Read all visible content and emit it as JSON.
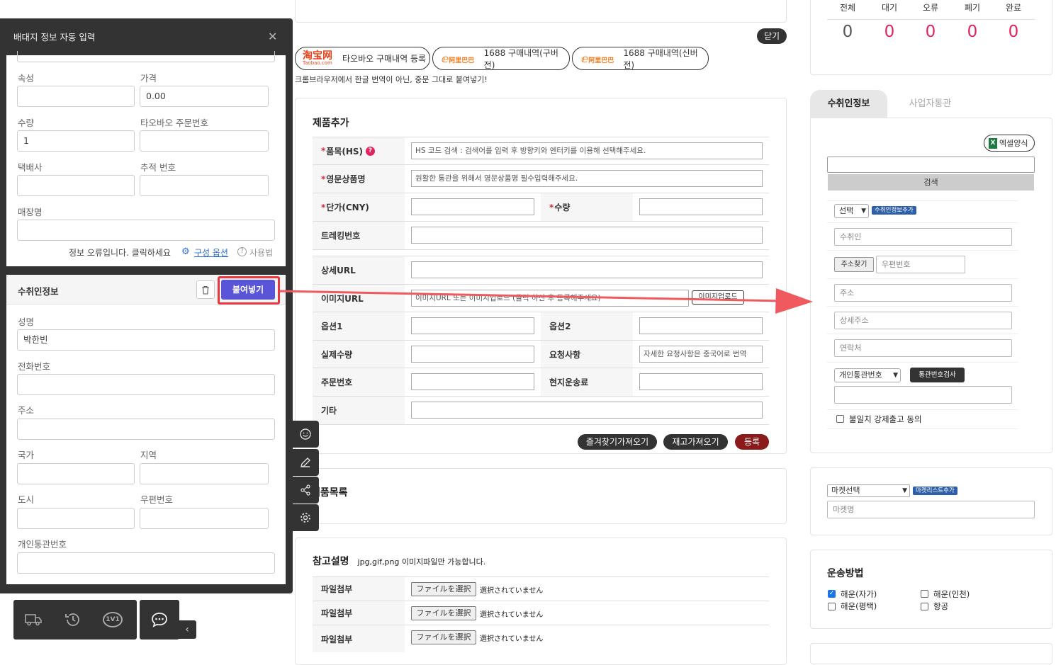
{
  "topcard": {
    "close_label": "닫기"
  },
  "purchase_buttons": [
    {
      "logo_main": "淘宝网",
      "logo_sub": "Taobao.com",
      "label": "타오바오 구매내역 등록"
    },
    {
      "logo_main": "阿里巴巴",
      "label": "1688 구매내역(구버전)"
    },
    {
      "logo_main": "阿里巴巴",
      "label": "1688 구매내역(신버전)"
    }
  ],
  "notice": "크롬브라우저에서 한글 번역이 아닌, 중문 그대로 붙여넣기!",
  "product_add": {
    "title": "제품추가",
    "hs_label": "품목(HS)",
    "hs_help": "?",
    "hs_placeholder": "HS 코드 검색 : 검색어를 입력 후 방향키와 엔터키를 이용해 선택해주세요.",
    "eng_label": "영문상품명",
    "eng_placeholder": "원활한 통관을 위해서 영문상품명 필수입력해주세요.",
    "price_label": "단가(CNY)",
    "qty_label": "수량",
    "tracking_label": "트레킹번호",
    "detail_url_label": "상세URL",
    "image_url_label": "이미지URL",
    "image_url_placeholder": "이미지URL 또는 이미지업로드 (클릭 하신 후 등록해주세요)",
    "image_upload": "이미지업로드",
    "option1_label": "옵션1",
    "option2_label": "옵션2",
    "actual_qty_label": "실제수량",
    "request_label": "요청사항",
    "request_placeholder": "자세한 요청사항은 중국어로 번역",
    "order_no_label": "주문번호",
    "local_ship_label": "현지운송료",
    "etc_label": "기타",
    "btn_favorites": "즐겨찾기가져오기",
    "btn_stock": "재고가져오기",
    "btn_register": "등록"
  },
  "product_list": {
    "title": "제품목록"
  },
  "ref": {
    "title": "참고설명",
    "note": "jpg,gif,png 이미지파일만 가능합니다.",
    "rows": [
      {
        "label": "파일첨부",
        "button": "ファイルを選択",
        "status": "選択されていません"
      },
      {
        "label": "파일첨부",
        "button": "ファイルを選択",
        "status": "選択されていません"
      },
      {
        "label": "파일첨부",
        "button": "ファイルを選択",
        "status": "選択されていません"
      }
    ]
  },
  "status_counts": [
    {
      "label": "전체",
      "value": "0"
    },
    {
      "label": "대기",
      "value": "0"
    },
    {
      "label": "오류",
      "value": "0"
    },
    {
      "label": "폐기",
      "value": "0"
    },
    {
      "label": "완료",
      "value": "0"
    }
  ],
  "right_tabs": {
    "active": "수취인정보",
    "inactive": "사업자통관"
  },
  "recipient": {
    "excel_label": "엑셀양식",
    "search_button": "검색",
    "select_value": "선택",
    "add_badge": "수취인정보추가",
    "name_placeholder": "수취인",
    "address_search": "주소찾기",
    "zip_placeholder": "우편번호",
    "address_placeholder": "주소",
    "detail_address_placeholder": "상세주소",
    "contact_placeholder": "연락처",
    "customs_select": "개인통관번호",
    "customs_check_button": "통관번호검사",
    "mismatch_label": "불일치 강제출고 동의"
  },
  "market": {
    "select": "마켓선택",
    "add_badge": "마켓리스트추가",
    "name_placeholder": "마켓명"
  },
  "shipping": {
    "title": "운송방법",
    "options": [
      {
        "label": "해운(자가)",
        "checked": true
      },
      {
        "label": "해운(인천)",
        "checked": false
      },
      {
        "label": "해운(평택)",
        "checked": false
      },
      {
        "label": "항공",
        "checked": false
      }
    ]
  },
  "popup": {
    "title": "배대지 정보 자동 입력",
    "fields": {
      "attr_label": "속성",
      "attr_value": "",
      "price_label": "가격",
      "price_value": "0.00",
      "qty_label": "수량",
      "qty_value": "1",
      "taobao_order_label": "타오바오 주문번호",
      "taobao_order_value": "",
      "courier_label": "택배사",
      "tracking_label": "추적 번호",
      "store_label": "매장명"
    },
    "footer_text": "정보 오류입니다. 클릭하세요",
    "config_link": "구성 옵션",
    "usage_link": "사용법",
    "recipient_section": {
      "title": "수취인정보",
      "paste_button": "붙여넣기",
      "name_label": "성명",
      "name_value": "박한빈",
      "phone_label": "전화번호",
      "address_label": "주소",
      "country_label": "국가",
      "region_label": "지역",
      "city_label": "도시",
      "zip_label": "우편번호",
      "customs_label": "개인통관번호"
    }
  },
  "bottom_bar": {
    "chat_badge": "1V1"
  },
  "colors": {
    "accent": "#5a54d8",
    "highlight": "#e8363c",
    "pink_number": "#e0245e",
    "dark": "#333333",
    "register": "#8b1a1a"
  }
}
